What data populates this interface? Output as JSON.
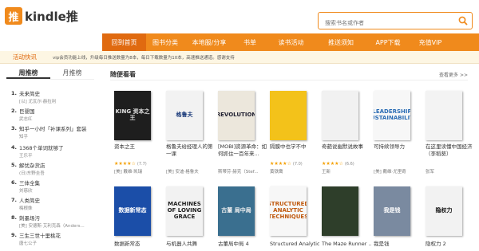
{
  "header": {
    "logo_badge": "推",
    "logo_text": "kindle推",
    "search_placeholder": "搜索书名或作者"
  },
  "nav": [
    "回到首页",
    "图书分类",
    "本地服/分享",
    "书单",
    "读书活动",
    "推送须知",
    "APP下载",
    "充值VIP"
  ],
  "notice": {
    "label": "活动快讯",
    "text": "vip会员功能上线，升级每日推送数量为8本，每日下载数量为10本，高速推送通道。感谢支持"
  },
  "sidebar": {
    "tabs": [
      "周推榜",
      "月推榜"
    ],
    "items": [
      {
        "num": "1.",
        "title": "未来简史",
        "author": "[以] 尤瓦尔·赫拉利"
      },
      {
        "num": "2.",
        "title": "巨婴国",
        "author": "武志红"
      },
      {
        "num": "3.",
        "title": "知乎一小时「补课系列」套装",
        "author": "知乎"
      },
      {
        "num": "4.",
        "title": "1368个单词就够了",
        "author": "王乐平"
      },
      {
        "num": "5.",
        "title": "解忧杂货店",
        "author": "(日)东野圭吾"
      },
      {
        "num": "6.",
        "title": "三体全集",
        "author": "刘慈欣"
      },
      {
        "num": "7.",
        "title": "人类简史",
        "author": "梅根姝"
      },
      {
        "num": "8.",
        "title": "刺墨场污",
        "author": "[美] 安德斯·艾利克森（Anders..."
      },
      {
        "num": "9.",
        "title": "三生三世十里桃花",
        "author": "唐七公子"
      }
    ]
  },
  "main": {
    "title": "随便看看",
    "more": "查看更多 >>",
    "books_row1": [
      {
        "title": "资本之王",
        "rating": "★★★★☆",
        "score": "(7.7)",
        "author": "[美] 戴维·凯瑞",
        "cover_text": "KING 资本之王",
        "cover_bg": "#1e1e1e",
        "cover_fg": "#e0e0e0"
      },
      {
        "title": "格鲁夫给经理人的第一课",
        "rating": "",
        "score": "",
        "author": "[美] 安迪·格鲁夫",
        "cover_text": "格鲁夫",
        "cover_bg": "#f2f2f2",
        "cover_fg": "#1a3a7a"
      },
      {
        "title": "[MOBI]资源革命：如何抓住一百年来...",
        "rating": "",
        "score": "",
        "author": "斯蒂芬·赫克（Stef...",
        "cover_text": "REVOLUTION",
        "cover_bg": "#ece7dc",
        "cover_fg": "#223"
      },
      {
        "title": "隔膜中也学不中",
        "rating": "★★★★☆",
        "score": "(7.0)",
        "author": "黄铁鹰",
        "cover_text": "",
        "cover_bg": "#f3c21a",
        "cover_fg": "#fff"
      },
      {
        "title": "奇葩说幽默说故事",
        "rating": "★★★★☆",
        "score": "(6.6)",
        "author": "王新",
        "cover_text": "",
        "cover_bg": "#f1f1f1",
        "cover_fg": "#333"
      },
      {
        "title": "可持续领导力",
        "rating": "",
        "score": "",
        "author": "[美] 戴维·尤里奇",
        "cover_text": "LEADERSHIP SUSTAINABILITY",
        "cover_bg": "#f7f7f7",
        "cover_fg": "#2c6db5"
      },
      {
        "title": "在这里读懂中国经济（李稻葵）",
        "rating": "",
        "score": "",
        "author": "张军",
        "cover_text": "",
        "cover_bg": "#f3f3f3",
        "cover_fg": "#333"
      }
    ],
    "books_row2": [
      {
        "title": "数据新常态",
        "cover_text": "数据新常态",
        "cover_bg": "#1b4ea8",
        "cover_fg": "#fff"
      },
      {
        "title": "与机器人共舞",
        "cover_text": "MACHINES OF LOVING GRACE",
        "cover_bg": "#f2f2f2",
        "cover_fg": "#222"
      },
      {
        "title": "古董局中局 4",
        "cover_text": "古董 局中局",
        "cover_bg": "#3a6f8f",
        "cover_fg": "#f0f0f0"
      },
      {
        "title": "Structured Analytic...",
        "cover_text": "STRUCTURED ANALYTIC TECHNIQUES",
        "cover_bg": "#f7f7f7",
        "cover_fg": "#c05a10"
      },
      {
        "title": "The Maze Runner ...",
        "cover_text": "",
        "cover_bg": "#2e3e2a",
        "cover_fg": "#9fdc3a"
      },
      {
        "title": "我是钱",
        "cover_text": "我是钱",
        "cover_bg": "#7a8aa0",
        "cover_fg": "#fff"
      },
      {
        "title": "隐权力 2",
        "cover_text": "隐权力",
        "cover_bg": "#f2f2f2",
        "cover_fg": "#111"
      }
    ]
  },
  "colors": {
    "accent": "#f08a1c",
    "accent_dark": "#e06a10"
  }
}
